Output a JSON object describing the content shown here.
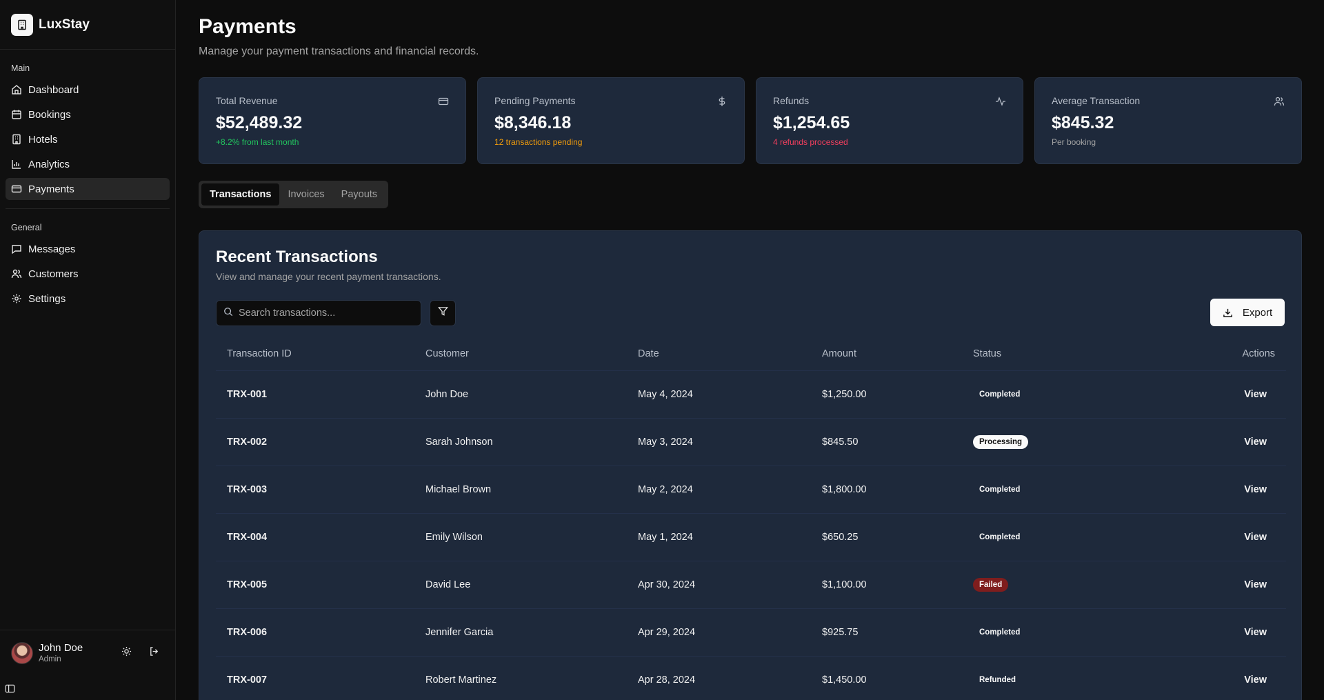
{
  "brand": {
    "name": "LuxStay"
  },
  "sidebar": {
    "sections": [
      {
        "heading": "Main",
        "items": [
          {
            "label": "Dashboard",
            "icon": "home-icon"
          },
          {
            "label": "Bookings",
            "icon": "calendar-icon"
          },
          {
            "label": "Hotels",
            "icon": "building-icon"
          },
          {
            "label": "Analytics",
            "icon": "bar-chart-icon"
          },
          {
            "label": "Payments",
            "icon": "credit-card-icon",
            "active": true
          }
        ]
      },
      {
        "heading": "General",
        "items": [
          {
            "label": "Messages",
            "icon": "message-icon"
          },
          {
            "label": "Customers",
            "icon": "users-icon"
          },
          {
            "label": "Settings",
            "icon": "gear-icon"
          }
        ]
      }
    ]
  },
  "user": {
    "name": "John Doe",
    "role": "Admin"
  },
  "page": {
    "title": "Payments",
    "subtitle": "Manage your payment transactions and financial records."
  },
  "cards": [
    {
      "label": "Total Revenue",
      "value": "$52,489.32",
      "note": "+8.2% from last month",
      "note_color": "#22c55e",
      "icon": "credit-card-icon"
    },
    {
      "label": "Pending Payments",
      "value": "$8,346.18",
      "note": "12 transactions pending",
      "note_color": "#f59e0b",
      "icon": "dollar-icon"
    },
    {
      "label": "Refunds",
      "value": "$1,254.65",
      "note": "4 refunds processed",
      "note_color": "#f43f5e",
      "icon": "activity-icon"
    },
    {
      "label": "Average Transaction",
      "value": "$845.32",
      "note": "Per booking",
      "note_color": "#a3a3a3",
      "icon": "users-icon"
    }
  ],
  "tabs": [
    {
      "label": "Transactions",
      "active": true
    },
    {
      "label": "Invoices",
      "active": false
    },
    {
      "label": "Payouts",
      "active": false
    }
  ],
  "transactions": {
    "title": "Recent Transactions",
    "subtitle": "View and manage your recent payment transactions.",
    "search_placeholder": "Search transactions...",
    "export_label": "Export",
    "columns": [
      "Transaction ID",
      "Customer",
      "Date",
      "Amount",
      "Status",
      "Actions"
    ],
    "rows": [
      {
        "id": "TRX-001",
        "customer": "John Doe",
        "date": "May 4, 2024",
        "amount": "$1,250.00",
        "status": "Completed",
        "action": "View"
      },
      {
        "id": "TRX-002",
        "customer": "Sarah Johnson",
        "date": "May 3, 2024",
        "amount": "$845.50",
        "status": "Processing",
        "action": "View"
      },
      {
        "id": "TRX-003",
        "customer": "Michael Brown",
        "date": "May 2, 2024",
        "amount": "$1,800.00",
        "status": "Completed",
        "action": "View"
      },
      {
        "id": "TRX-004",
        "customer": "Emily Wilson",
        "date": "May 1, 2024",
        "amount": "$650.25",
        "status": "Completed",
        "action": "View"
      },
      {
        "id": "TRX-005",
        "customer": "David Lee",
        "date": "Apr 30, 2024",
        "amount": "$1,100.00",
        "status": "Failed",
        "action": "View"
      },
      {
        "id": "TRX-006",
        "customer": "Jennifer Garcia",
        "date": "Apr 29, 2024",
        "amount": "$925.75",
        "status": "Completed",
        "action": "View"
      },
      {
        "id": "TRX-007",
        "customer": "Robert Martinez",
        "date": "Apr 28, 2024",
        "amount": "$1,450.00",
        "status": "Refunded",
        "action": "View"
      }
    ]
  }
}
